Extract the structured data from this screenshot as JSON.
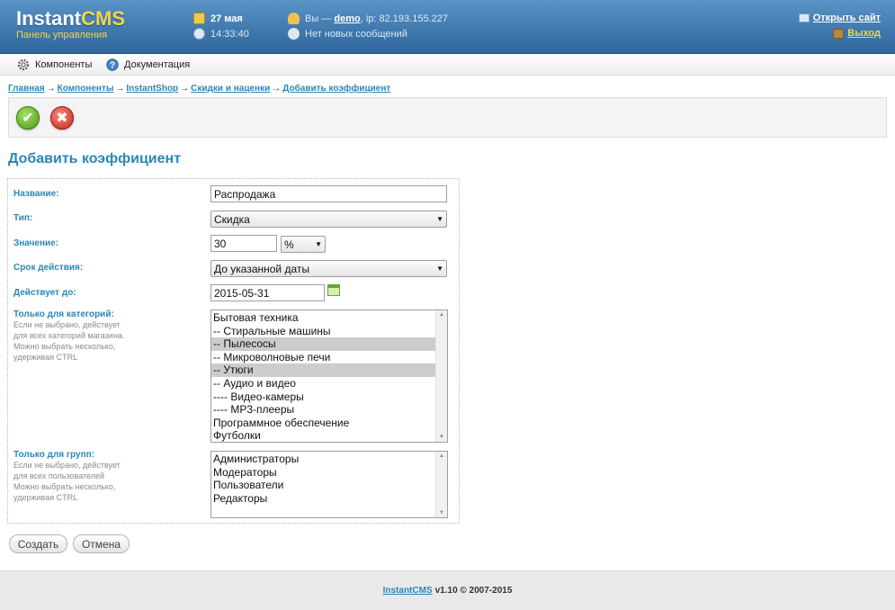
{
  "header": {
    "logo_main": "Instant",
    "logo_accent": "CMS",
    "logo_sub": "Панель управления",
    "date": "27 мая",
    "time": "14:33:40",
    "user_prefix": "Вы —",
    "user_name": "demo",
    "user_ip": ", ip: 82.193.155.227",
    "messages": "Нет новых сообщений",
    "open_site": "Открыть сайт",
    "logout": "Выход"
  },
  "menu": {
    "components": "Компоненты",
    "docs": "Документация"
  },
  "breadcrumb": [
    {
      "label": "Главная"
    },
    {
      "label": "Компоненты"
    },
    {
      "label": "InstantShop"
    },
    {
      "label": "Скидки и наценки"
    },
    {
      "label": "Добавить коэффициент"
    }
  ],
  "breadcrumb_sep": "→",
  "toolbar": {
    "ok_glyph": "✔",
    "cancel_glyph": "✖"
  },
  "page_title": "Добавить коэффициент",
  "form": {
    "name_label": "Название:",
    "name_value": "Распродажа",
    "type_label": "Тип:",
    "type_value": "Скидка",
    "value_label": "Значение:",
    "value_value": "30",
    "unit_value": "%",
    "period_label": "Срок действия:",
    "period_value": "До указанной даты",
    "until_label": "Действует до:",
    "until_value": "2015-05-31",
    "categories_label": "Только для категорий:",
    "categories_hint": [
      "Если не выбрано, действует",
      "для всех категорий магазина.",
      "Можно выбрать несколько,",
      "удерживая CTRL"
    ],
    "categories": [
      {
        "label": "Бытовая техника",
        "selected": false
      },
      {
        "label": "-- Стиральные машины",
        "selected": false
      },
      {
        "label": "-- Пылесосы",
        "selected": true
      },
      {
        "label": "-- Микроволновые печи",
        "selected": false
      },
      {
        "label": "-- Утюги",
        "selected": true
      },
      {
        "label": "-- Аудио и видео",
        "selected": false
      },
      {
        "label": "---- Видео-камеры",
        "selected": false
      },
      {
        "label": "---- MP3-плееры",
        "selected": false
      },
      {
        "label": "Программное обеспечение",
        "selected": false
      },
      {
        "label": "Футболки",
        "selected": false
      }
    ],
    "groups_label": "Только для групп:",
    "groups_hint": [
      "Если не выбрано, действует",
      "для всех пользователей",
      "Можно выбрать несколько,",
      "удерживая CTRL"
    ],
    "groups": [
      {
        "label": "Администраторы"
      },
      {
        "label": "Модераторы"
      },
      {
        "label": "Пользователи"
      },
      {
        "label": "Редакторы"
      }
    ],
    "submit_label": "Создать",
    "cancel_label": "Отмена"
  },
  "footer": {
    "link": "InstantCMS",
    "text": "v1.10 © 2007-2015"
  },
  "colors": {
    "header_blue": "#3a73a8",
    "logo_yellow": "#f1d54a",
    "accent_blue": "#2b86b8"
  }
}
